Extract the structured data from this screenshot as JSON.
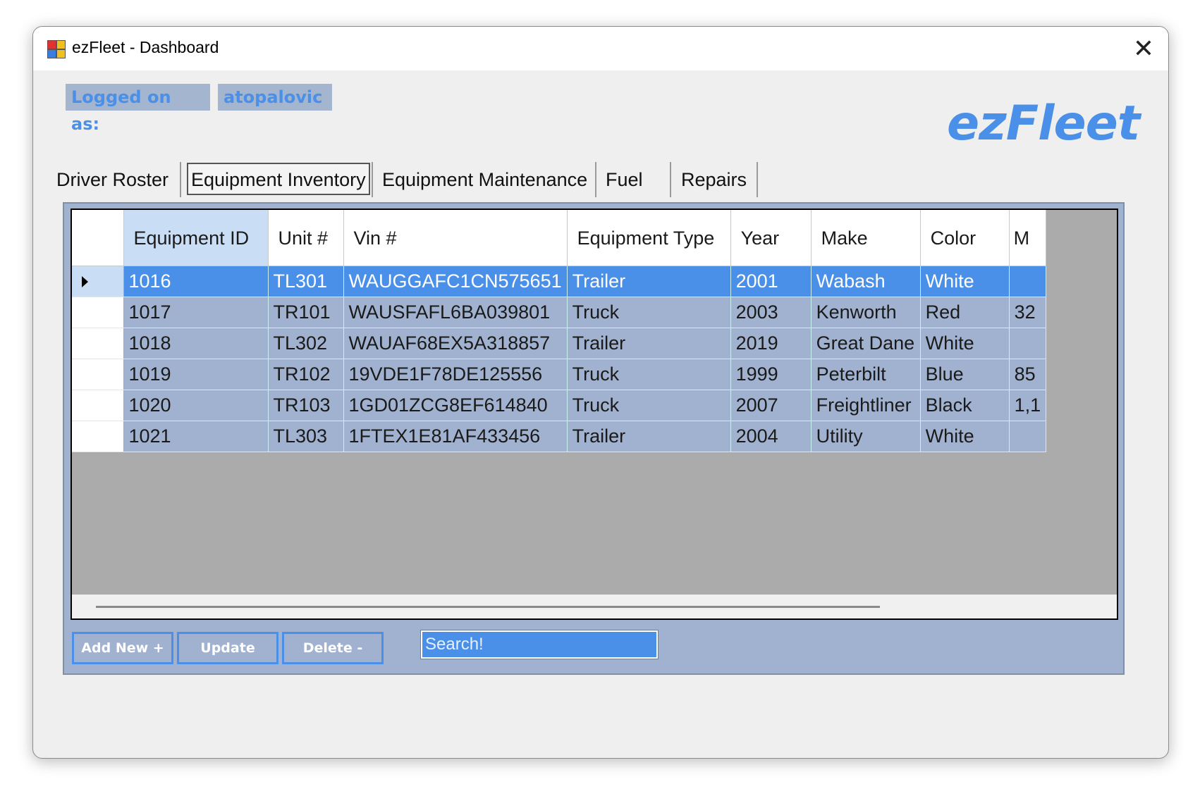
{
  "window": {
    "title": "ezFleet - Dashboard"
  },
  "session": {
    "logged_on_label": "Logged on as:",
    "username": "atopalovic"
  },
  "logo": "ezFleet",
  "tabs": [
    {
      "label": "Driver Roster",
      "active": false
    },
    {
      "label": "Equipment Inventory",
      "active": true
    },
    {
      "label": "Equipment Maintenance",
      "active": false
    },
    {
      "label": "Fuel",
      "active": false
    },
    {
      "label": "Repairs",
      "active": false
    }
  ],
  "grid": {
    "columns": [
      "Equipment ID",
      "Unit #",
      "Vin #",
      "Equipment Type",
      "Year",
      "Make",
      "Color",
      "M"
    ],
    "rows": [
      [
        "1016",
        "TL301",
        "WAUGGAFC1CN575651",
        "Trailer",
        "2001",
        "Wabash",
        "White",
        ""
      ],
      [
        "1017",
        "TR101",
        "WAUSFAFL6BA039801",
        "Truck",
        "2003",
        "Kenworth",
        "Red",
        "32"
      ],
      [
        "1018",
        "TL302",
        "WAUAF68EX5A318857",
        "Trailer",
        "2019",
        "Great Dane",
        "White",
        ""
      ],
      [
        "1019",
        "TR102",
        "19VDE1F78DE125556",
        "Truck",
        "1999",
        "Peterbilt",
        "Blue",
        "85"
      ],
      [
        "1020",
        "TR103",
        "1GD01ZCG8EF614840",
        "Truck",
        "2007",
        "Freightliner",
        "Black",
        "1,1"
      ],
      [
        "1021",
        "TL303",
        "1FTEX1E81AF433456",
        "Trailer",
        "2004",
        "Utility",
        "White",
        ""
      ]
    ],
    "selected_row": 0
  },
  "actions": {
    "add_label": "Add New +",
    "update_label": "Update",
    "delete_label": "Delete -"
  },
  "search": {
    "placeholder": "Search!"
  },
  "colors": {
    "accent": "#4a90e8",
    "panel": "#a0b2cf",
    "grid_empty": "#ababab"
  }
}
